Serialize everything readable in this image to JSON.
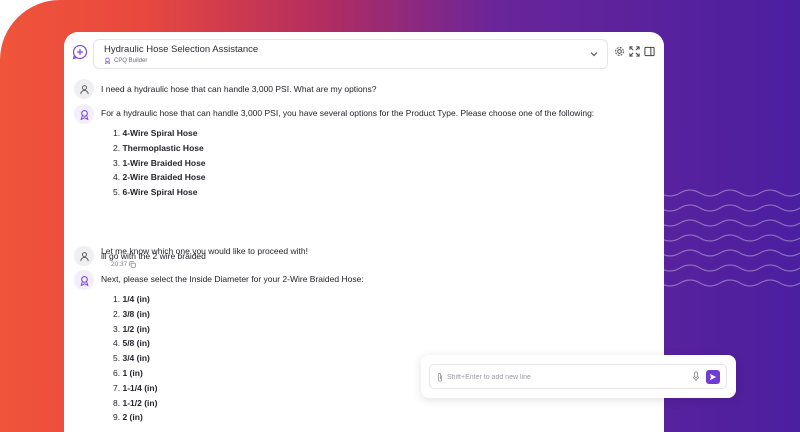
{
  "header": {
    "title": "Hydraulic Hose Selection Assistance",
    "subtitle": "CPQ Builder"
  },
  "messages": [
    {
      "role": "user",
      "text": "I need a hydraulic hose that can handle 3,000 PSI. What are my options?"
    },
    {
      "role": "assistant",
      "text": "For a hydraulic hose that can handle 3,000 PSI, you have several options for the Product Type. Please choose one of the following:",
      "options": [
        {
          "num": "1.",
          "label": "4-Wire Spiral Hose"
        },
        {
          "num": "2.",
          "label": "Thermoplastic Hose"
        },
        {
          "num": "3.",
          "label": "1-Wire Braided Hose"
        },
        {
          "num": "4.",
          "label": "2-Wire Braided Hose"
        },
        {
          "num": "5.",
          "label": "6-Wire Spiral Hose"
        }
      ],
      "closing": "Let me know which one you would like to proceed with!",
      "time": "20:37"
    },
    {
      "role": "user",
      "text": "ill go with the 2 wire braided"
    },
    {
      "role": "assistant",
      "text": "Next, please select the Inside Diameter for your 2-Wire Braided Hose:",
      "options": [
        {
          "num": "1.",
          "label": "1/4 (in)"
        },
        {
          "num": "2.",
          "label": "3/8 (in)"
        },
        {
          "num": "3.",
          "label": "1/2 (in)"
        },
        {
          "num": "4.",
          "label": "5/8 (in)"
        },
        {
          "num": "5.",
          "label": "3/4 (in)"
        },
        {
          "num": "6.",
          "label": "1 (in)"
        },
        {
          "num": "7.",
          "label": "1-1/4 (in)"
        },
        {
          "num": "8.",
          "label": "1-1/2 (in)"
        },
        {
          "num": "9.",
          "label": "2 (in)"
        }
      ]
    }
  ],
  "input": {
    "placeholder": "Shift+Enter to add new line",
    "value": ""
  },
  "icons": {
    "new_chat": "chat-plus-icon",
    "settings": "gear-icon",
    "expand": "expand-icon",
    "sidebar": "sidebar-icon",
    "attach": "paperclip-icon",
    "mic": "microphone-icon",
    "send": "send-icon"
  },
  "colors": {
    "accent": "#6f3cd6",
    "gradient_start": "#f0543a",
    "gradient_end": "#4a1fa0"
  }
}
